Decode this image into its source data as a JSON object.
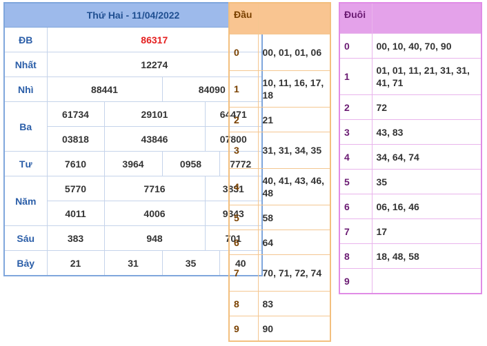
{
  "results": {
    "title": "Thứ Hai - 11/04/2022",
    "db_label": "ĐB",
    "db_value": "86317",
    "nhat_label": "Nhất",
    "nhat_value": "12274",
    "nhi_label": "Nhì",
    "nhi_values": [
      "88441",
      "84090"
    ],
    "ba_label": "Ba",
    "ba_values": [
      "61734",
      "29101",
      "64471",
      "03818",
      "43846",
      "07800"
    ],
    "tu_label": "Tư",
    "tu_values": [
      "7610",
      "3964",
      "0958",
      "7772"
    ],
    "nam_label": "Năm",
    "nam_values": [
      "5770",
      "7716",
      "3831",
      "4011",
      "4006",
      "9343"
    ],
    "sau_label": "Sáu",
    "sau_values": [
      "383",
      "948",
      "701"
    ],
    "bay_label": "Bảy",
    "bay_values": [
      "21",
      "31",
      "35",
      "40"
    ]
  },
  "dau": {
    "header": "Đầu",
    "rows": [
      {
        "key": "0",
        "value": "00, 01, 01, 06"
      },
      {
        "key": "1",
        "value": "10, 11, 16, 17, 18"
      },
      {
        "key": "2",
        "value": "21"
      },
      {
        "key": "3",
        "value": "31, 31, 34, 35"
      },
      {
        "key": "4",
        "value": "40, 41, 43, 46, 48"
      },
      {
        "key": "5",
        "value": "58"
      },
      {
        "key": "6",
        "value": "64"
      },
      {
        "key": "7",
        "value": "70, 71, 72, 74"
      },
      {
        "key": "8",
        "value": "83"
      },
      {
        "key": "9",
        "value": "90"
      }
    ]
  },
  "duoi": {
    "header": "Đuôi",
    "rows": [
      {
        "key": "0",
        "value": "00, 10, 40, 70, 90"
      },
      {
        "key": "1",
        "value": "01, 01, 11, 21, 31, 31, 41, 71"
      },
      {
        "key": "2",
        "value": "72"
      },
      {
        "key": "3",
        "value": "43, 83"
      },
      {
        "key": "4",
        "value": "34, 64, 74"
      },
      {
        "key": "5",
        "value": "35"
      },
      {
        "key": "6",
        "value": "06, 16, 46"
      },
      {
        "key": "7",
        "value": "17"
      },
      {
        "key": "8",
        "value": "18, 48, 58"
      },
      {
        "key": "9",
        "value": ""
      }
    ]
  },
  "colors": {
    "results_header": "#9dbaeb",
    "results_border": "#7fa6dc",
    "db_red": "#e41e1e",
    "dau_header": "#f9c591",
    "dau_border": "#f3bf7e",
    "duoi_header": "#e4a2ea",
    "duoi_border": "#e08ce6"
  }
}
